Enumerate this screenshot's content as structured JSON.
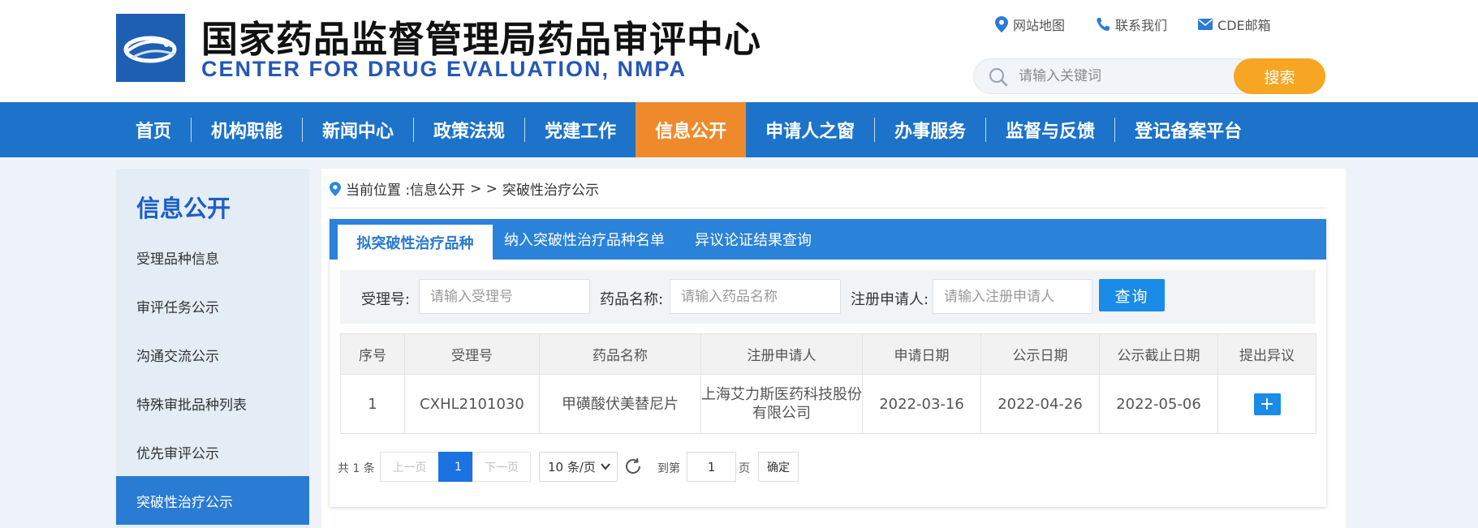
{
  "header": {
    "title_cn": "国家药品监督管理局药品审评中心",
    "title_en": "CENTER FOR DRUG EVALUATION, NMPA",
    "top_links": [
      {
        "label": "网站地图",
        "icon": "map-pin-icon"
      },
      {
        "label": "联系我们",
        "icon": "phone-icon"
      },
      {
        "label": "CDE邮箱",
        "icon": "mail-icon"
      }
    ],
    "search": {
      "placeholder": "请输入关键词",
      "button": "搜索"
    }
  },
  "nav": {
    "items": [
      "首页",
      "机构职能",
      "新闻中心",
      "政策法规",
      "党建工作",
      "信息公开",
      "申请人之窗",
      "办事服务",
      "监督与反馈",
      "登记备案平台"
    ],
    "active_index": 5
  },
  "sidebar": {
    "title": "信息公开",
    "items": [
      "受理品种信息",
      "审评任务公示",
      "沟通交流公示",
      "特殊审批品种列表",
      "优先审评公示",
      "突破性治疗公示"
    ],
    "active_index": 5
  },
  "breadcrumb": {
    "prefix": "当前位置 : ",
    "section": "信息公开",
    "separator": "> >",
    "page": "突破性治疗公示"
  },
  "tabs": {
    "items": [
      "拟突破性治疗品种",
      "纳入突破性治疗品种名单",
      "异议论证结果查询"
    ],
    "active_index": 0
  },
  "filter": {
    "accept_no_label": "受理号:",
    "accept_no_placeholder": "请输入受理号",
    "drug_name_label": "药品名称:",
    "drug_name_placeholder": "请输入药品名称",
    "applicant_label": "注册申请人:",
    "applicant_placeholder": "请输入注册申请人",
    "query_button": "查询"
  },
  "table": {
    "columns": [
      "序号",
      "受理号",
      "药品名称",
      "注册申请人",
      "申请日期",
      "公示日期",
      "公示截止日期",
      "提出异议"
    ],
    "rows": [
      {
        "index": "1",
        "accept_no": "CXHL2101030",
        "drug_name": "甲磺酸伏美替尼片",
        "applicant": "上海艾力斯医药科技股份有限公司",
        "apply_date": "2022-03-16",
        "publish_date": "2022-04-26",
        "deadline": "2022-05-06",
        "objection": "+"
      }
    ]
  },
  "pagination": {
    "total": "共 1 条",
    "prev": "上一页",
    "current": "1",
    "next": "下一页",
    "page_size": "10 条/页",
    "goto_label": "到第",
    "goto_value": "1",
    "page_unit": "页",
    "confirm": "确定"
  },
  "colors": {
    "nav_bg": "#1c73c9",
    "nav_active": "#ee8a2c",
    "search_btn": "#f6a623",
    "tab_bar": "#2b82d9",
    "primary_btn": "#1a8be6",
    "sidebar_active": "#2a7bd3"
  }
}
